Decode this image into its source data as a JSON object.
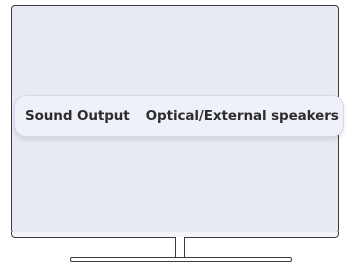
{
  "setting": {
    "label": "Sound Output",
    "value": "Optical/External speakers"
  }
}
